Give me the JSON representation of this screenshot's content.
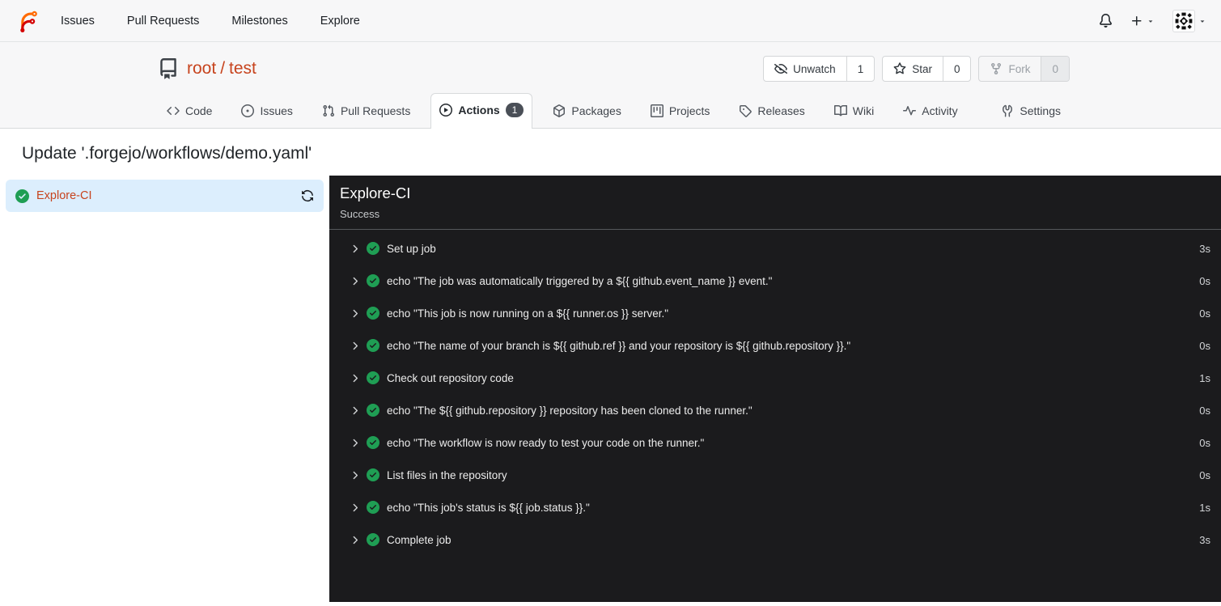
{
  "navbar": {
    "logo_icon": "forgejo-logo",
    "items": [
      {
        "label": "Issues"
      },
      {
        "label": "Pull Requests"
      },
      {
        "label": "Milestones"
      },
      {
        "label": "Explore"
      }
    ],
    "right": {
      "bell_icon": "bell-icon",
      "create_icon": "plus-icon",
      "avatar_icon": "identicon-avatar",
      "caret_icon": "triangle-down-icon"
    }
  },
  "repo_header": {
    "repo_icon": "repo-book-icon",
    "owner": "root",
    "separator": "/",
    "name": "test",
    "actions": [
      {
        "label": "Unwatch",
        "count": "1",
        "icon": "eye-closed-icon",
        "disabled": false
      },
      {
        "label": "Star",
        "count": "0",
        "icon": "star-icon",
        "disabled": false
      },
      {
        "label": "Fork",
        "count": "0",
        "icon": "repo-forked-icon",
        "disabled": true
      }
    ],
    "tabs": [
      {
        "label": "Code",
        "icon": "code-icon"
      },
      {
        "label": "Issues",
        "icon": "issue-opened-icon"
      },
      {
        "label": "Pull Requests",
        "icon": "git-pull-request-icon"
      },
      {
        "label": "Actions",
        "icon": "play-circle-icon",
        "badge": "1",
        "active": true
      },
      {
        "label": "Packages",
        "icon": "package-icon"
      },
      {
        "label": "Projects",
        "icon": "project-icon"
      },
      {
        "label": "Releases",
        "icon": "tag-icon"
      },
      {
        "label": "Wiki",
        "icon": "book-icon"
      },
      {
        "label": "Activity",
        "icon": "pulse-icon"
      },
      {
        "label": "Settings",
        "icon": "tools-icon"
      }
    ]
  },
  "page": {
    "title": "Update '.forgejo/workflows/demo.yaml'"
  },
  "sidebar": {
    "jobs": [
      {
        "name": "Explore-CI",
        "status": "success",
        "status_icon": "check-circle-icon",
        "rerun_icon": "sync-icon"
      }
    ]
  },
  "run_panel": {
    "job_name": "Explore-CI",
    "status": "Success",
    "steps": [
      {
        "name": "Set up job",
        "duration": "3s"
      },
      {
        "name": "echo \"The job was automatically triggered by a ${{ github.event_name }} event.\"",
        "duration": "0s"
      },
      {
        "name": "echo \"This job is now running on a ${{ runner.os }} server.\"",
        "duration": "0s"
      },
      {
        "name": "echo \"The name of your branch is ${{ github.ref }} and your repository is ${{ github.repository }}.\"",
        "duration": "0s"
      },
      {
        "name": "Check out repository code",
        "duration": "1s"
      },
      {
        "name": "echo \"The ${{ github.repository }} repository has been cloned to the runner.\"",
        "duration": "0s"
      },
      {
        "name": "echo \"The workflow is now ready to test your code on the runner.\"",
        "duration": "0s"
      },
      {
        "name": "List files in the repository",
        "duration": "0s"
      },
      {
        "name": "echo \"This job's status is ${{ job.status }}.\"",
        "duration": "1s"
      },
      {
        "name": "Complete job",
        "duration": "3s"
      }
    ]
  },
  "colors": {
    "primary_link": "#c7441e",
    "success_green": "#1f9e54",
    "selected_job_bg": "#dceefd",
    "panel_bg": "#1b1b1d",
    "header_bg": "#f7f7f8",
    "badge_bg": "#4a4f57"
  }
}
